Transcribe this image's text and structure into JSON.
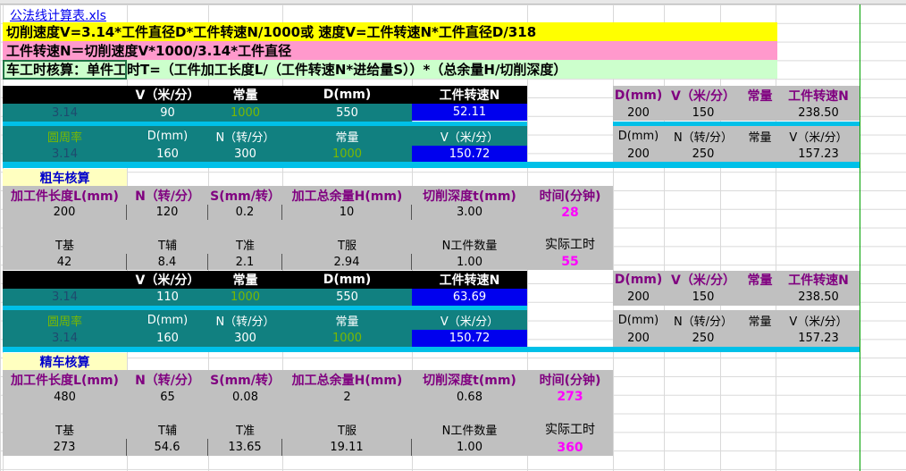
{
  "file_link": "公法线计算表.xls",
  "formulas": {
    "line1": "切削速度V=3.14*工件直径D*工件转速N/1000或   速度V=工件转速N*工件直径D/318",
    "line2": "工件转速N＝切削速度V*1000/3.14*工件直径",
    "line3": "车工时核算：单件工时T=（工件加工长度L/（工件转速N*进给量S））*（总余量H/切削深度）"
  },
  "colors": {
    "yellow": "#ffff00",
    "pink": "#ff99cc",
    "mint": "#ccffcc",
    "teal": "#118080",
    "blue": "#0000ee",
    "gray": "#c0c0c0",
    "cyan": "#00c0e8"
  },
  "calc1": {
    "header": [
      "",
      "V（米/分）",
      "常量",
      "D(mm)",
      "工件转速N"
    ],
    "row1": [
      "3.14",
      "90",
      "1000",
      "550",
      "52.11"
    ],
    "header2": [
      "圆周率",
      "D(mm)",
      "N（转/分）",
      "常量",
      "V（米/分）"
    ],
    "row2": [
      "3.14",
      "160",
      "300",
      "1000",
      "150.72"
    ]
  },
  "calc2": {
    "header": [
      "",
      "V（米/分）",
      "常量",
      "D(mm)",
      "工件转速N"
    ],
    "row1": [
      "3.14",
      "110",
      "1000",
      "550",
      "63.69"
    ],
    "header2": [
      "圆周率",
      "D(mm)",
      "N（转/分）",
      "常量",
      "V（米/分）"
    ],
    "row2": [
      "3.14",
      "160",
      "300",
      "1000",
      "150.72"
    ]
  },
  "side": {
    "header1": [
      "D(mm)",
      "V（米/分）",
      "常量",
      "工件转速N"
    ],
    "values1": [
      "200",
      "150",
      "",
      "238.50"
    ],
    "header2": [
      "D(mm)",
      "N（转/分）",
      "常量",
      "V（米/分）"
    ],
    "values2": [
      "200",
      "250",
      "",
      "157.23"
    ]
  },
  "rough": {
    "title": "粗车核算",
    "header": [
      "加工件长度L(mm)",
      "N（转/分）",
      "S(mm/转）",
      "加工总余量H(mm)",
      "切削深度t(mm)",
      "时间(分钟)"
    ],
    "values": [
      "200",
      "120",
      "0.2",
      "10",
      "3.00",
      "28"
    ],
    "header2": [
      "T基",
      "T辅",
      "T准",
      "T服",
      "N工件数量",
      "实际工时"
    ],
    "values2": [
      "42",
      "8.4",
      "2.1",
      "2.94",
      "1.00",
      "55"
    ]
  },
  "fine": {
    "title": "精车核算",
    "header": [
      "加工件长度L(mm)",
      "N（转/分）",
      "S(mm/转）",
      "加工总余量H(mm)",
      "切削深度t(mm)",
      "时间(分钟)"
    ],
    "values": [
      "480",
      "65",
      "0.08",
      "2",
      "0.68",
      "273"
    ],
    "header2": [
      "T基",
      "T辅",
      "T准",
      "T服",
      "N工件数量",
      "实际工时"
    ],
    "values2": [
      "273",
      "54.6",
      "13.65",
      "19.11",
      "1.00",
      "360"
    ]
  }
}
